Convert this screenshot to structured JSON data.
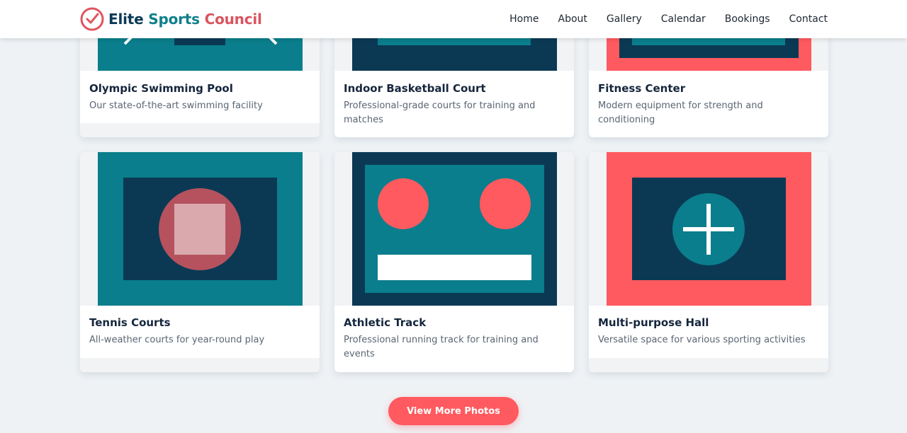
{
  "brand": {
    "part1": "Elite ",
    "part2": "Sports ",
    "part3": "Council",
    "icon": "check-circle-icon"
  },
  "nav": {
    "home": "Home",
    "about": "About",
    "gallery": "Gallery",
    "calendar": "Calendar",
    "bookings": "Bookings",
    "contact": "Contact"
  },
  "cards": [
    {
      "title": "Olympic Swimming Pool",
      "desc": "Our state-of-the-art swimming facility"
    },
    {
      "title": "Indoor Basketball Court",
      "desc": "Professional-grade courts for training and matches"
    },
    {
      "title": "Fitness Center",
      "desc": "Modern equipment for strength and conditioning"
    },
    {
      "title": "Tennis Courts",
      "desc": "All-weather courts for year-round play"
    },
    {
      "title": "Athletic Track",
      "desc": "Professional running track for training and events"
    },
    {
      "title": "Multi-purpose Hall",
      "desc": "Versatile space for various sporting activities"
    }
  ],
  "button": {
    "label": "View More Photos"
  },
  "colors": {
    "teal": "#0a7e8c",
    "navy": "#0b3954",
    "coral": "#ff5a5f",
    "white": "#ffffff"
  }
}
